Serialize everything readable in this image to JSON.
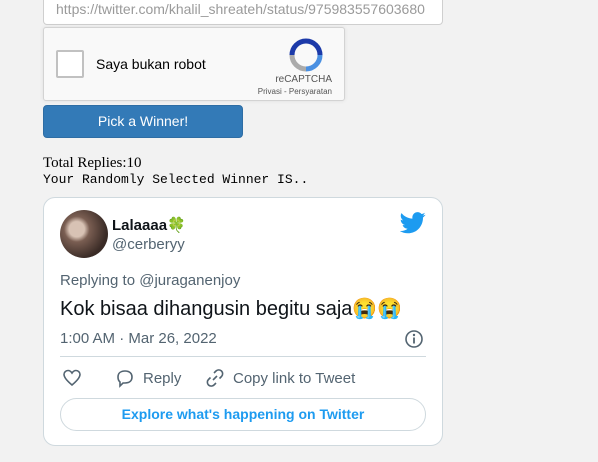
{
  "form": {
    "url_value": "https://twitter.com/khalil_shreateh/status/975983557603680"
  },
  "captcha": {
    "label": "Saya bukan robot",
    "brand": "reCAPTCHA",
    "links": "Privasi - Persyaratan"
  },
  "button": {
    "pick": "Pick a Winner!"
  },
  "result": {
    "total_replies": "Total Replies:10",
    "winner_intro": "Your Randomly Selected Winner IS.."
  },
  "tweet": {
    "name": "Lalaaaa",
    "name_emoji": "🍀",
    "handle": "@cerberyy",
    "replying_to": "Replying to @juraganenjoy",
    "text": "Kok bisaa dihangusin begitu saja😭😭",
    "timestamp": "1:00 AM · Mar 26, 2022",
    "reply_label": "Reply",
    "copy_link_label": "Copy link to Tweet",
    "explore_label": "Explore what's happening on Twitter"
  },
  "colors": {
    "button_blue": "#337ab7",
    "twitter_blue": "#1d9bf0",
    "muted_text": "#536471"
  },
  "icons": [
    "recaptcha-logo-icon",
    "twitter-bird-icon",
    "info-icon",
    "heart-icon",
    "reply-bubble-icon",
    "link-icon"
  ]
}
